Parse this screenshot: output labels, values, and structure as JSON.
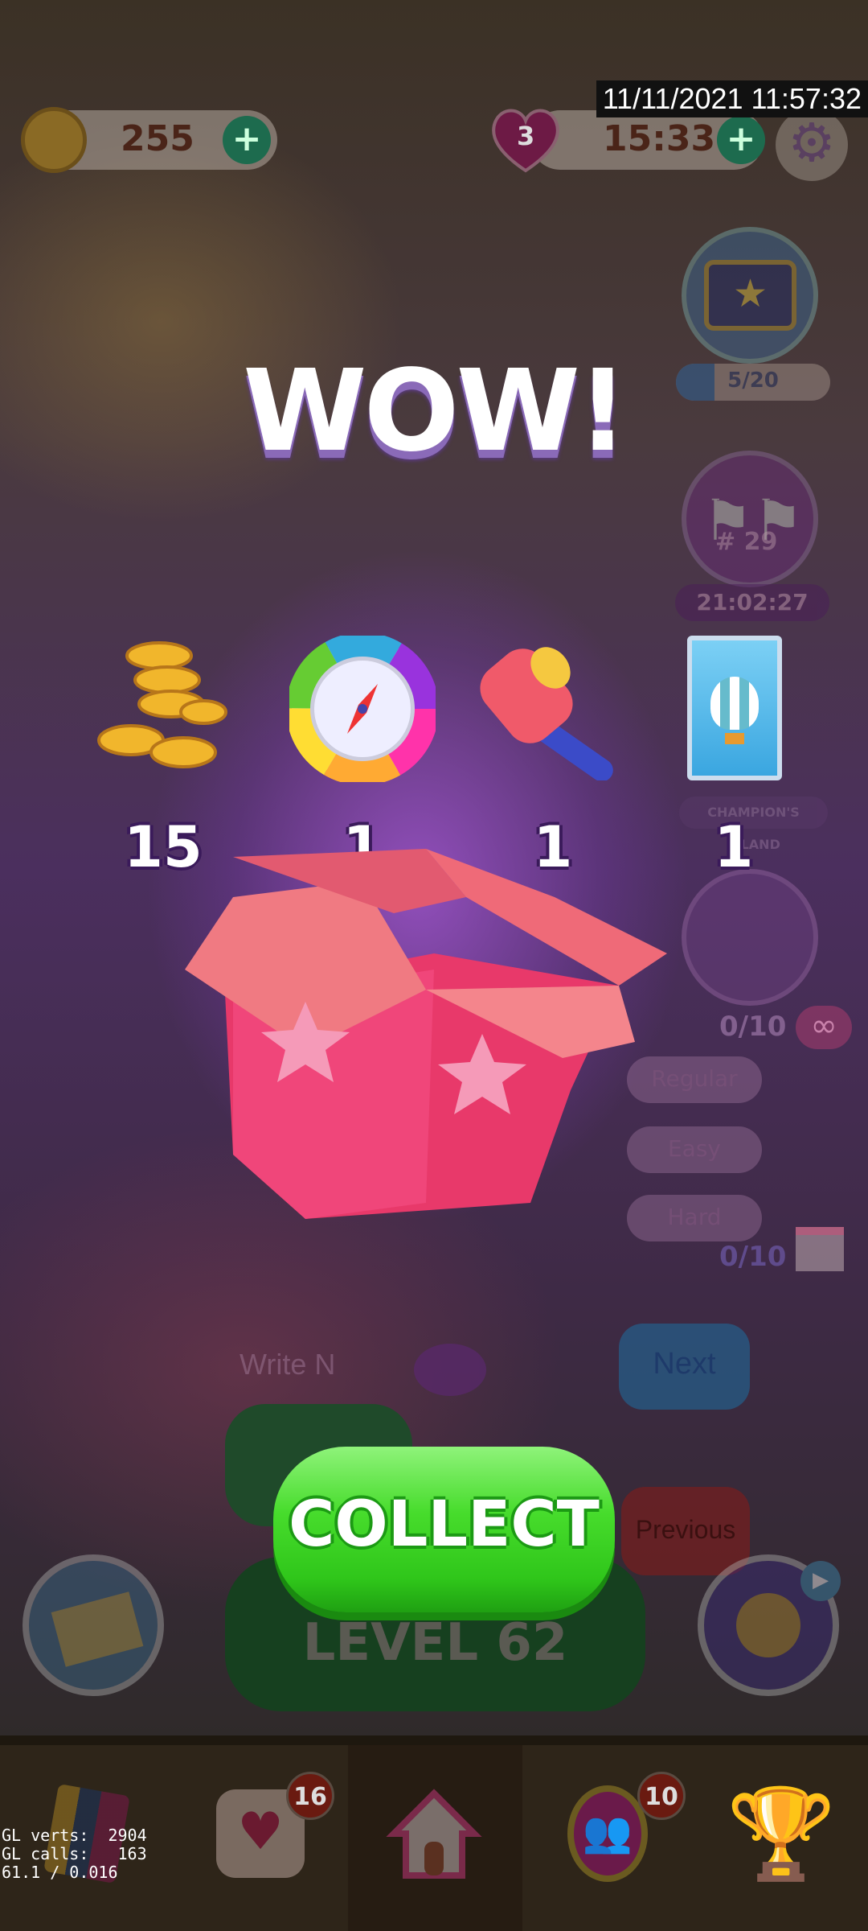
{
  "status": {
    "datetime": "11/11/2021 11:57:32"
  },
  "hud": {
    "coins": "255",
    "lives": "3",
    "life_timer": "15:33"
  },
  "side": {
    "chest_progress": "5/20",
    "race_rank": "# 29",
    "race_timer": "21:02:27",
    "island_label": "CHAMPION'S ISLAND",
    "compass_progress": "0/10",
    "difficulty": [
      "Regular",
      "Easy",
      "Hard"
    ],
    "gift_progress": "0/10",
    "next": "Next",
    "previous": "Previous"
  },
  "board": {
    "write_hint": "Write N",
    "level": "LEVEL 62"
  },
  "popup": {
    "title": "WOW!",
    "rewards": [
      {
        "icon": "coins-icon",
        "count": "15"
      },
      {
        "icon": "compass-icon",
        "count": "1"
      },
      {
        "icon": "hammer-icon",
        "count": "1"
      },
      {
        "icon": "balloon-card-icon",
        "count": "1"
      }
    ],
    "collect": "COLLECT"
  },
  "nav": {
    "mail_badge": "16",
    "team_badge": "10"
  },
  "debug": {
    "line1": "GL verts:  2904",
    "line2": "GL calls:   163",
    "line3": "61.1 / 0.016"
  },
  "colors": {
    "collect": "#3fd62a",
    "title": "#ffffff",
    "overlay": "#4b2f5e"
  }
}
